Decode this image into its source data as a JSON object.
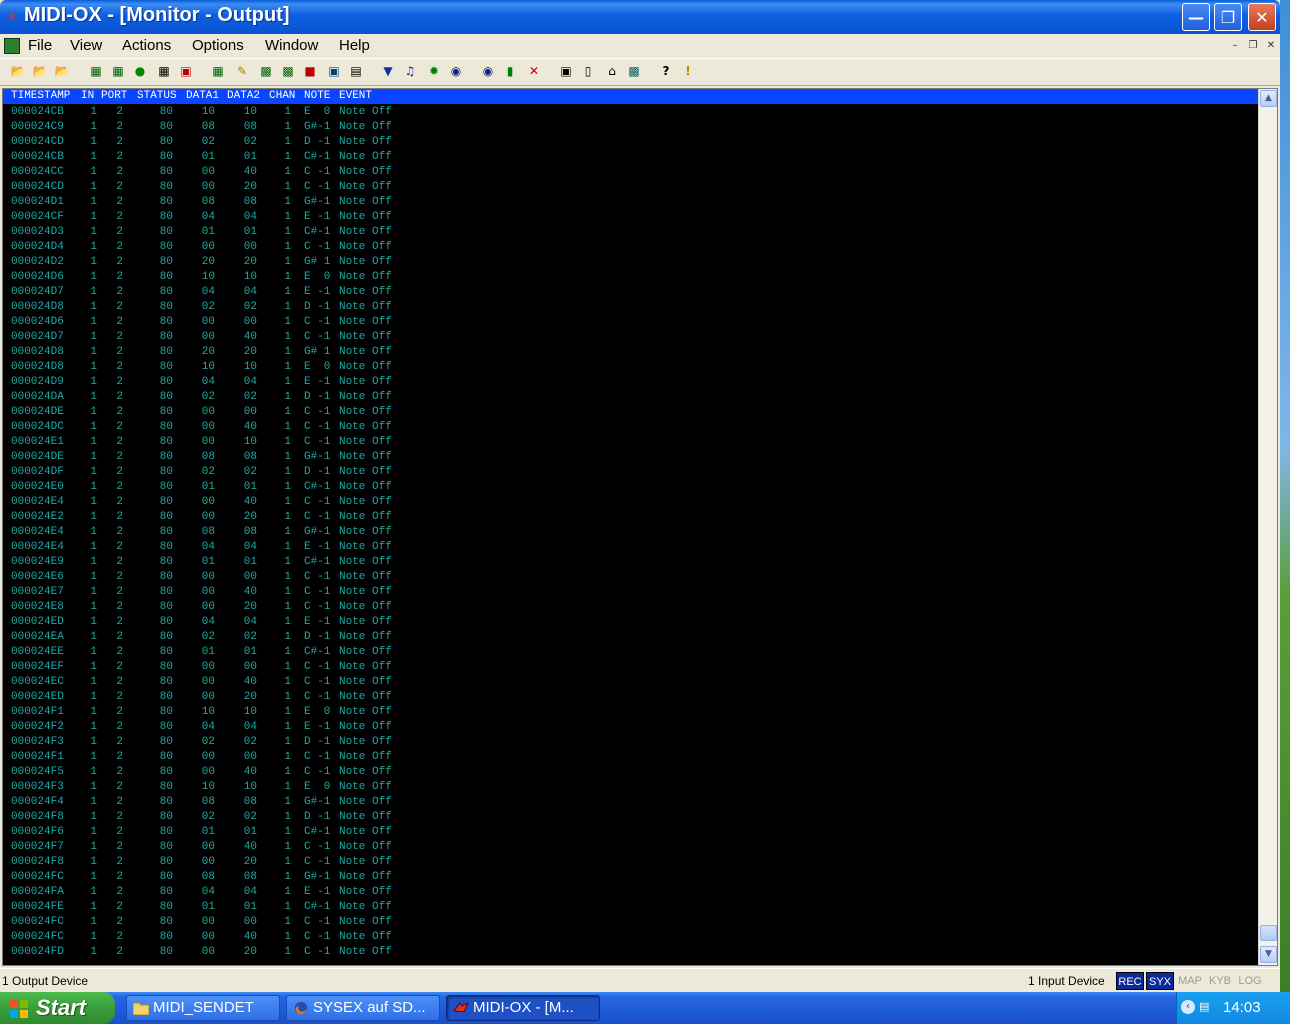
{
  "window": {
    "title": "MIDI-OX - [Monitor - Output]"
  },
  "menu": [
    "File",
    "View",
    "Actions",
    "Options",
    "Window",
    "Help"
  ],
  "monitor": {
    "columns": [
      "TIMESTAMP",
      "IN",
      "PORT",
      "STATUS",
      "DATA1",
      "DATA2",
      "CHAN",
      "NOTE",
      "EVENT"
    ],
    "rows": [
      [
        "000024CB",
        "1",
        "2",
        "80",
        "10",
        "10",
        "1",
        "E  0",
        "Note Off"
      ],
      [
        "000024C9",
        "1",
        "2",
        "80",
        "08",
        "08",
        "1",
        "G#-1",
        "Note Off"
      ],
      [
        "000024CD",
        "1",
        "2",
        "80",
        "02",
        "02",
        "1",
        "D -1",
        "Note Off"
      ],
      [
        "000024CB",
        "1",
        "2",
        "80",
        "01",
        "01",
        "1",
        "C#-1",
        "Note Off"
      ],
      [
        "000024CC",
        "1",
        "2",
        "80",
        "00",
        "40",
        "1",
        "C -1",
        "Note Off"
      ],
      [
        "000024CD",
        "1",
        "2",
        "80",
        "00",
        "20",
        "1",
        "C -1",
        "Note Off"
      ],
      [
        "000024D1",
        "1",
        "2",
        "80",
        "08",
        "08",
        "1",
        "G#-1",
        "Note Off"
      ],
      [
        "000024CF",
        "1",
        "2",
        "80",
        "04",
        "04",
        "1",
        "E -1",
        "Note Off"
      ],
      [
        "000024D3",
        "1",
        "2",
        "80",
        "01",
        "01",
        "1",
        "C#-1",
        "Note Off"
      ],
      [
        "000024D4",
        "1",
        "2",
        "80",
        "00",
        "00",
        "1",
        "C -1",
        "Note Off"
      ],
      [
        "000024D2",
        "1",
        "2",
        "80",
        "20",
        "20",
        "1",
        "G# 1",
        "Note Off"
      ],
      [
        "000024D6",
        "1",
        "2",
        "80",
        "10",
        "10",
        "1",
        "E  0",
        "Note Off"
      ],
      [
        "000024D7",
        "1",
        "2",
        "80",
        "04",
        "04",
        "1",
        "E -1",
        "Note Off"
      ],
      [
        "000024D8",
        "1",
        "2",
        "80",
        "02",
        "02",
        "1",
        "D -1",
        "Note Off"
      ],
      [
        "000024D6",
        "1",
        "2",
        "80",
        "00",
        "00",
        "1",
        "C -1",
        "Note Off"
      ],
      [
        "000024D7",
        "1",
        "2",
        "80",
        "00",
        "40",
        "1",
        "C -1",
        "Note Off"
      ],
      [
        "000024D8",
        "1",
        "2",
        "80",
        "20",
        "20",
        "1",
        "G# 1",
        "Note Off"
      ],
      [
        "000024D8",
        "1",
        "2",
        "80",
        "10",
        "10",
        "1",
        "E  0",
        "Note Off"
      ],
      [
        "000024D9",
        "1",
        "2",
        "80",
        "04",
        "04",
        "1",
        "E -1",
        "Note Off"
      ],
      [
        "000024DA",
        "1",
        "2",
        "80",
        "02",
        "02",
        "1",
        "D -1",
        "Note Off"
      ],
      [
        "000024DE",
        "1",
        "2",
        "80",
        "00",
        "00",
        "1",
        "C -1",
        "Note Off"
      ],
      [
        "000024DC",
        "1",
        "2",
        "80",
        "00",
        "40",
        "1",
        "C -1",
        "Note Off"
      ],
      [
        "000024E1",
        "1",
        "2",
        "80",
        "00",
        "10",
        "1",
        "C -1",
        "Note Off"
      ],
      [
        "000024DE",
        "1",
        "2",
        "80",
        "08",
        "08",
        "1",
        "G#-1",
        "Note Off"
      ],
      [
        "000024DF",
        "1",
        "2",
        "80",
        "02",
        "02",
        "1",
        "D -1",
        "Note Off"
      ],
      [
        "000024E0",
        "1",
        "2",
        "80",
        "01",
        "01",
        "1",
        "C#-1",
        "Note Off"
      ],
      [
        "000024E4",
        "1",
        "2",
        "80",
        "00",
        "40",
        "1",
        "C -1",
        "Note Off"
      ],
      [
        "000024E2",
        "1",
        "2",
        "80",
        "00",
        "20",
        "1",
        "C -1",
        "Note Off"
      ],
      [
        "000024E4",
        "1",
        "2",
        "80",
        "08",
        "08",
        "1",
        "G#-1",
        "Note Off"
      ],
      [
        "000024E4",
        "1",
        "2",
        "80",
        "04",
        "04",
        "1",
        "E -1",
        "Note Off"
      ],
      [
        "000024E9",
        "1",
        "2",
        "80",
        "01",
        "01",
        "1",
        "C#-1",
        "Note Off"
      ],
      [
        "000024E6",
        "1",
        "2",
        "80",
        "00",
        "00",
        "1",
        "C -1",
        "Note Off"
      ],
      [
        "000024E7",
        "1",
        "2",
        "80",
        "00",
        "40",
        "1",
        "C -1",
        "Note Off"
      ],
      [
        "000024E8",
        "1",
        "2",
        "80",
        "00",
        "20",
        "1",
        "C -1",
        "Note Off"
      ],
      [
        "000024ED",
        "1",
        "2",
        "80",
        "04",
        "04",
        "1",
        "E -1",
        "Note Off"
      ],
      [
        "000024EA",
        "1",
        "2",
        "80",
        "02",
        "02",
        "1",
        "D -1",
        "Note Off"
      ],
      [
        "000024EE",
        "1",
        "2",
        "80",
        "01",
        "01",
        "1",
        "C#-1",
        "Note Off"
      ],
      [
        "000024EF",
        "1",
        "2",
        "80",
        "00",
        "00",
        "1",
        "C -1",
        "Note Off"
      ],
      [
        "000024EC",
        "1",
        "2",
        "80",
        "00",
        "40",
        "1",
        "C -1",
        "Note Off"
      ],
      [
        "000024ED",
        "1",
        "2",
        "80",
        "00",
        "20",
        "1",
        "C -1",
        "Note Off"
      ],
      [
        "000024F1",
        "1",
        "2",
        "80",
        "10",
        "10",
        "1",
        "E  0",
        "Note Off"
      ],
      [
        "000024F2",
        "1",
        "2",
        "80",
        "04",
        "04",
        "1",
        "E -1",
        "Note Off"
      ],
      [
        "000024F3",
        "1",
        "2",
        "80",
        "02",
        "02",
        "1",
        "D -1",
        "Note Off"
      ],
      [
        "000024F1",
        "1",
        "2",
        "80",
        "00",
        "00",
        "1",
        "C -1",
        "Note Off"
      ],
      [
        "000024F5",
        "1",
        "2",
        "80",
        "00",
        "40",
        "1",
        "C -1",
        "Note Off"
      ],
      [
        "000024F3",
        "1",
        "2",
        "80",
        "10",
        "10",
        "1",
        "E  0",
        "Note Off"
      ],
      [
        "000024F4",
        "1",
        "2",
        "80",
        "08",
        "08",
        "1",
        "G#-1",
        "Note Off"
      ],
      [
        "000024F8",
        "1",
        "2",
        "80",
        "02",
        "02",
        "1",
        "D -1",
        "Note Off"
      ],
      [
        "000024F6",
        "1",
        "2",
        "80",
        "01",
        "01",
        "1",
        "C#-1",
        "Note Off"
      ],
      [
        "000024F7",
        "1",
        "2",
        "80",
        "00",
        "40",
        "1",
        "C -1",
        "Note Off"
      ],
      [
        "000024F8",
        "1",
        "2",
        "80",
        "00",
        "20",
        "1",
        "C -1",
        "Note Off"
      ],
      [
        "000024FC",
        "1",
        "2",
        "80",
        "08",
        "08",
        "1",
        "G#-1",
        "Note Off"
      ],
      [
        "000024FA",
        "1",
        "2",
        "80",
        "04",
        "04",
        "1",
        "E -1",
        "Note Off"
      ],
      [
        "000024FE",
        "1",
        "2",
        "80",
        "01",
        "01",
        "1",
        "C#-1",
        "Note Off"
      ],
      [
        "000024FC",
        "1",
        "2",
        "80",
        "00",
        "00",
        "1",
        "C -1",
        "Note Off"
      ],
      [
        "000024FC",
        "1",
        "2",
        "80",
        "00",
        "40",
        "1",
        "C -1",
        "Note Off"
      ],
      [
        "000024FD",
        "1",
        "2",
        "80",
        "00",
        "20",
        "1",
        "C -1",
        "Note Off"
      ]
    ]
  },
  "statusbar": {
    "left": "1 Output Device",
    "input_devices": "1 Input Device",
    "indicators": [
      {
        "label": "REC",
        "active": true
      },
      {
        "label": "SYX",
        "active": true
      },
      {
        "label": "MAP",
        "active": false
      },
      {
        "label": "KYB",
        "active": false
      },
      {
        "label": "LOG",
        "active": false
      }
    ]
  },
  "taskbar": {
    "start_label": "Start",
    "tasks": [
      {
        "label": "MIDI_SENDET",
        "icon": "folder-icon",
        "active": false
      },
      {
        "label": "SYSEX auf SD...",
        "icon": "firefox-icon",
        "active": false
      },
      {
        "label": "MIDI-OX - [M...",
        "icon": "midiox-icon",
        "active": true
      }
    ],
    "clock": "14:03"
  },
  "colors": {
    "text_cyan": "#1fa9a3",
    "header_blue": "#0a46ff",
    "indicator_on": "#0a2a9a"
  }
}
